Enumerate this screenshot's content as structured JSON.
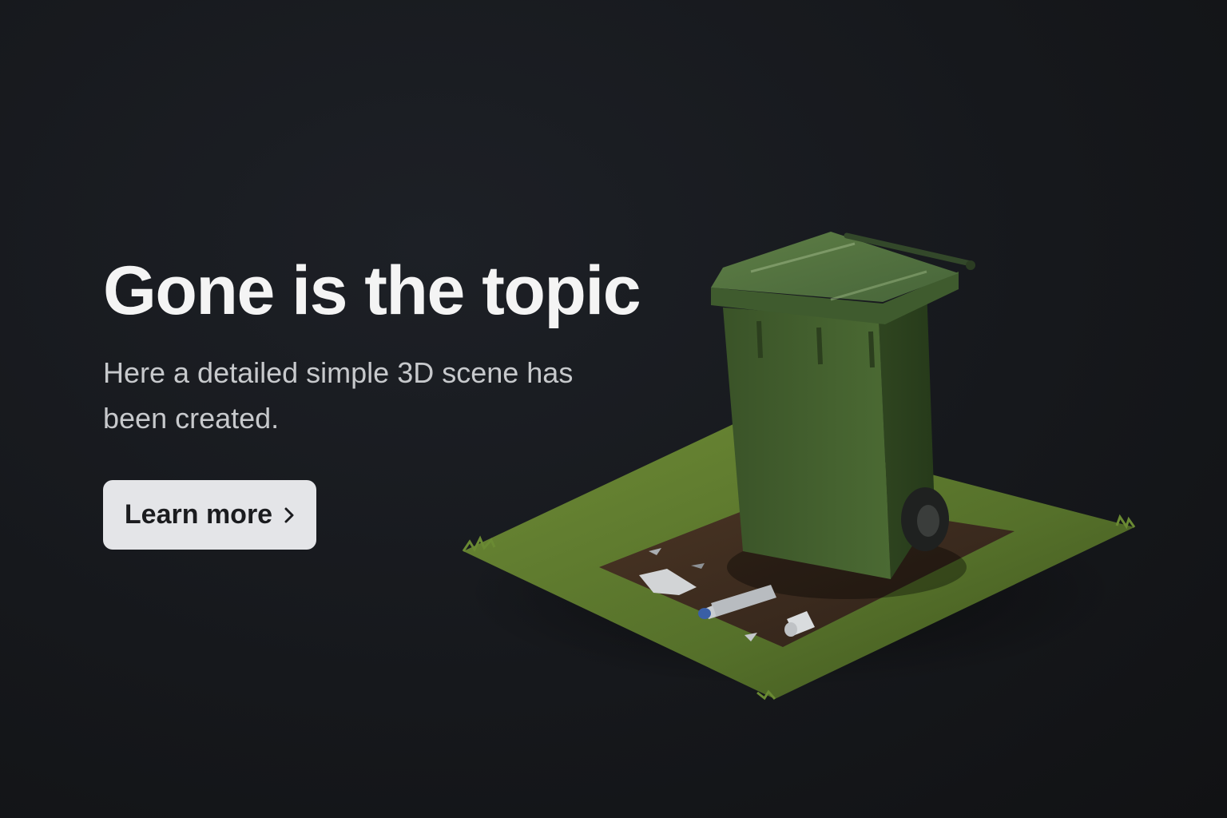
{
  "hero": {
    "title": "Gone is the topic",
    "subtitle": "Here a detailed simple 3D scene has been created.",
    "cta_label": "Learn more",
    "cta_icon": "chevron-right-icon"
  },
  "scene": {
    "bin_color": "#3f5a2c",
    "grass_color": "#55702a",
    "soil_color": "#3b2a1e"
  },
  "colors": {
    "background": "#16181c",
    "title": "#f4f4f4",
    "subtitle": "#c7c9cc",
    "button_bg": "#e4e5e8",
    "button_text": "#1b1c1f"
  }
}
